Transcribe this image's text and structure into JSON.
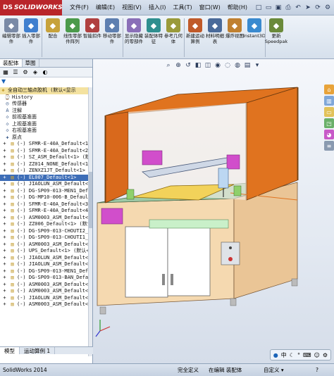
{
  "app": {
    "logo_text": "SOLIDWORKS",
    "logo_prefix": "DS"
  },
  "menu": [
    "文件(F)",
    "编辑(E)",
    "视图(V)",
    "插入(I)",
    "工具(T)",
    "窗口(W)",
    "帮助(H)"
  ],
  "quick_tools": [
    "new-icon",
    "open-icon",
    "save-icon",
    "print-icon",
    "undo-icon",
    "select-icon",
    "rebuild-icon",
    "options-icon"
  ],
  "ribbon": [
    {
      "label": "编辑零部件",
      "icon": "edit-component-icon",
      "color": "#7a8aa6"
    },
    {
      "label": "插入零部件",
      "icon": "insert-component-icon",
      "color": "#3f7fcf"
    },
    {
      "label": "配合",
      "icon": "mate-icon",
      "color": "#c7a23b"
    },
    {
      "label": "线性零部件阵列",
      "icon": "pattern-icon",
      "color": "#4b9a4b"
    },
    {
      "label": "智能扣件",
      "icon": "smart-fastener-icon",
      "color": "#b04040"
    },
    {
      "label": "移动零部件",
      "icon": "move-component-icon",
      "color": "#5e7fb0"
    },
    {
      "label": "显示隐藏的零部件",
      "icon": "show-hidden-icon",
      "color": "#8a6fb8"
    },
    {
      "label": "装配体特征",
      "icon": "assembly-feature-icon",
      "color": "#2f8f8f"
    },
    {
      "label": "参考几何体",
      "icon": "ref-geometry-icon",
      "color": "#9a9a3a"
    },
    {
      "label": "新建运动算例",
      "icon": "motion-study-icon",
      "color": "#c05a2a"
    },
    {
      "label": "材料明细表",
      "icon": "bom-icon",
      "color": "#4a6a9a"
    },
    {
      "label": "爆炸视图",
      "icon": "exploded-view-icon",
      "color": "#c08030"
    },
    {
      "label": "Instant3D",
      "icon": "instant3d-icon",
      "color": "#3a8acf"
    },
    {
      "label": "更新Speedpak",
      "icon": "speedpak-icon",
      "color": "#6a8a3a"
    }
  ],
  "left_tabs": [
    "装配体",
    "草图"
  ],
  "bottom_tabs": [
    "模型",
    "运动算例 1"
  ],
  "tree_root": "全自动三轴点胶机  (默认<显示",
  "tree": [
    {
      "label": "History",
      "icon": "history-icon"
    },
    {
      "label": "传感器",
      "icon": "sensor-icon"
    },
    {
      "label": "注解",
      "icon": "annotation-icon"
    },
    {
      "label": "前视基准面",
      "icon": "plane-icon"
    },
    {
      "label": "上视基准面",
      "icon": "plane-icon"
    },
    {
      "label": "右视基准面",
      "icon": "plane-icon"
    },
    {
      "label": "原点",
      "icon": "origin-icon"
    },
    {
      "label": "(-) SFMR-E-40A_Default<1>",
      "icon": "part-icon"
    },
    {
      "label": "(-) SFMR-E-40A_Default<2>",
      "icon": "part-icon"
    },
    {
      "label": "(-) SZ_ASM_Default<1> (默认",
      "icon": "part-icon"
    },
    {
      "label": "(-) ZZ014_NONE_Default<1>",
      "icon": "part-icon"
    },
    {
      "label": "(-) ZENXZ1JT_Default<1> (默",
      "icon": "part-icon"
    },
    {
      "label": "(-) EL007_Default<1>",
      "icon": "part-icon",
      "state": "sel"
    },
    {
      "label": "(-) JIAOLUN_ASM_Default<1>",
      "icon": "part-icon"
    },
    {
      "label": "(-) DG-SP09-013-MEN1_Default",
      "icon": "part-icon"
    },
    {
      "label": "(-) DG-MP10-006-B_Default<1>",
      "icon": "part-icon"
    },
    {
      "label": "(-) SFMR-E-40A_Default<3>",
      "icon": "part-icon"
    },
    {
      "label": "(-) SFMR-E-40A_Default<4>",
      "icon": "part-icon"
    },
    {
      "label": "(-) ASM0003_ASM_Default<1>",
      "icon": "part-icon"
    },
    {
      "label": "(-) ZZ006_Default<1> (默认<",
      "icon": "part-icon"
    },
    {
      "label": "(-) DG-SP09-013-CHOUTI2_Def",
      "icon": "part-icon"
    },
    {
      "label": "(-) DG-SP09-013-CHOUTI1_Def",
      "icon": "part-icon"
    },
    {
      "label": "(-) ASM0003_ASM_Default<2>",
      "icon": "part-icon"
    },
    {
      "label": "(-) UPS_Default<1> (默认<<",
      "icon": "part-icon"
    },
    {
      "label": "(-) JIAOLUN_ASM_Default<2>",
      "icon": "part-icon"
    },
    {
      "label": "(-) JIAOLUN_ASM_Default<3>",
      "icon": "part-icon"
    },
    {
      "label": "(-) DG-SP09-013-MEN1_Default",
      "icon": "part-icon"
    },
    {
      "label": "(-) DG-SP09-013-BAN_Default",
      "icon": "part-icon"
    },
    {
      "label": "(-) ASM0003_ASM_Default<3>",
      "icon": "part-icon"
    },
    {
      "label": "(-) ASM0003_ASM_Default<4>",
      "icon": "part-icon"
    },
    {
      "label": "(-) JIAOLUN_ASM_Default<4>",
      "icon": "part-icon"
    },
    {
      "label": "(-) ASM0003_ASM_Default<5>",
      "icon": "part-icon"
    }
  ],
  "view_tools": [
    "zoom-fit-icon",
    "zoom-area-icon",
    "previous-view-icon",
    "section-view-icon",
    "view-orientation-icon",
    "display-style-icon",
    "hide-show-icon",
    "edit-appearance-icon",
    "scene-icon",
    "view-settings-icon"
  ],
  "task_pane": [
    "resources-icon",
    "design-library-icon",
    "file-explorer-icon",
    "view-palette-icon",
    "appearances-icon",
    "custom-properties-icon"
  ],
  "ime": {
    "mode": "中",
    "icons": [
      "moon-icon",
      "punct-icon",
      "keyboard-icon",
      "user-icon",
      "settings-icon"
    ]
  },
  "status": {
    "app": "SolidWorks 2014",
    "s1": "完全定义",
    "s2": "在编辑 装配体",
    "s3": "自定义 ▾",
    "help": "?"
  },
  "colors": {
    "orange": "#e0731f",
    "cabinet": "#f5d9b0",
    "green": "#8fd06b",
    "magenta": "#d14ecb",
    "yellow": "#f2d25a"
  }
}
